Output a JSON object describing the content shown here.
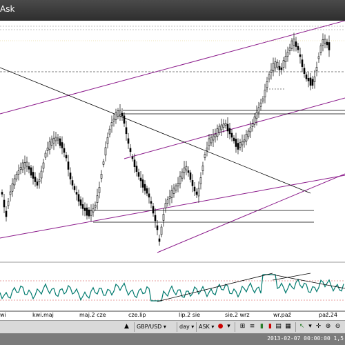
{
  "window": {
    "title": "Ask"
  },
  "xaxis": {
    "labels": [
      "wi",
      "kwi.maj",
      "maj.2 cze",
      "cze.lip",
      "lip.2 sie",
      "sie.2 wrz",
      "wr.paź",
      "paź.24"
    ]
  },
  "toolbar": {
    "symbol": "GBP/USD",
    "timeframe": "day",
    "price_type": "ASK"
  },
  "status": {
    "timestamp": "2013-02-07 00:00:00",
    "price": "1,5"
  },
  "colors": {
    "candle": "#000000",
    "channel": "#8b1a8b",
    "hline": "#000000",
    "dashed": "#555555",
    "oscillator": "#007a6e",
    "osc_band": "#d04040"
  },
  "icons": [
    "dropdown-arrow-icon",
    "red-marker-icon",
    "cursor-arrow-icon",
    "candlestick-icon",
    "crosshair-icon",
    "zoom-in-icon",
    "zoom-out-icon"
  ]
}
